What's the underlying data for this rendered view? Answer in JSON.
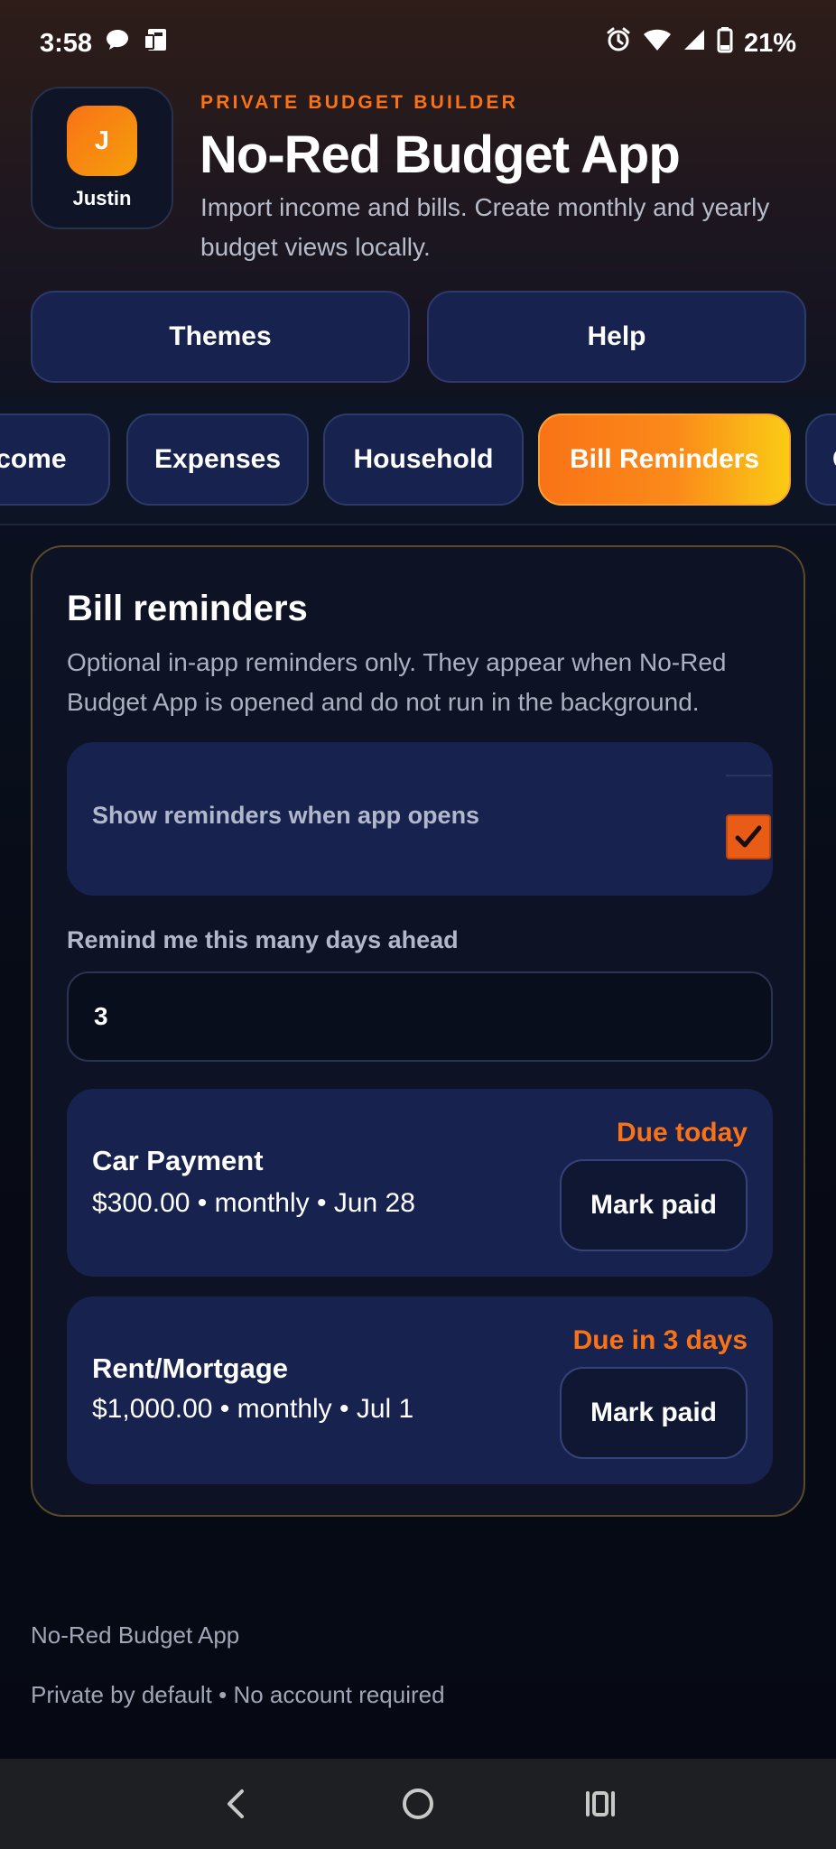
{
  "status_bar": {
    "time": "3:58",
    "battery": "21%"
  },
  "header": {
    "avatar_initial": "J",
    "avatar_name": "Justin",
    "kicker": "PRIVATE BUDGET BUILDER",
    "title": "No-Red Budget App",
    "description": "Import income and bills. Create monthly and yearly budget views locally."
  },
  "top_buttons": {
    "themes": "Themes",
    "help": "Help"
  },
  "tabs": [
    {
      "label": "Income"
    },
    {
      "label": "Expenses"
    },
    {
      "label": "Household"
    },
    {
      "label": "Bill Reminders",
      "active": true
    },
    {
      "label": "G"
    }
  ],
  "reminders": {
    "title": "Bill reminders",
    "description": "Optional in-app reminders only. They appear when No-Red Budget App is opened and do not run in the background.",
    "show_on_open_label": "Show reminders when app opens",
    "show_on_open_checked": true,
    "days_ahead_label": "Remind me this many days ahead",
    "days_ahead_value": "3",
    "bills": [
      {
        "name": "Car Payment",
        "meta": "$300.00 • monthly • Jun 28",
        "due": "Due today",
        "action": "Mark paid"
      },
      {
        "name": "Rent/Mortgage",
        "meta": "$1,000.00 • monthly • Jul 1",
        "due": "Due in 3 days",
        "action": "Mark paid"
      }
    ]
  },
  "footer": {
    "line1": "No-Red Budget App",
    "line2": "Private by default • No account required"
  },
  "colors": {
    "accent": "#f97316",
    "card_bg": "#17224e",
    "checkbox": "#e85c17"
  }
}
